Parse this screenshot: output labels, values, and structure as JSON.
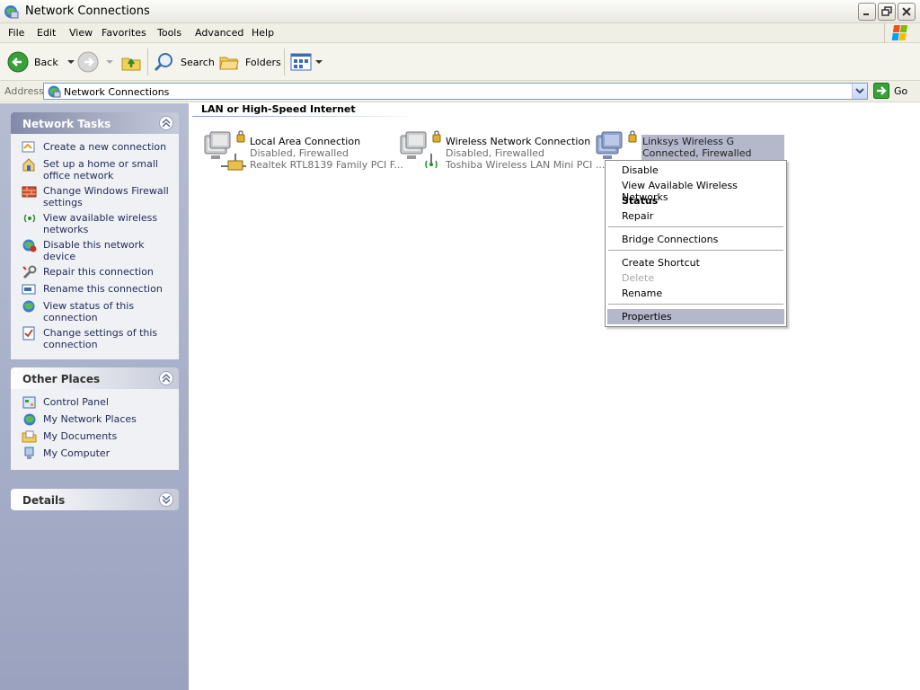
{
  "window": {
    "title": "Network Connections"
  },
  "menu": {
    "items": [
      "File",
      "Edit",
      "View",
      "Favorites",
      "Tools",
      "Advanced",
      "Help"
    ]
  },
  "toolbar": {
    "back": "Back",
    "search": "Search",
    "folders": "Folders"
  },
  "address": {
    "label": "Address",
    "value": "Network Connections",
    "go": "Go"
  },
  "network_tasks": {
    "title": "Network Tasks",
    "items": [
      [
        "Create a new connection"
      ],
      [
        "Set up a home or small",
        "office network"
      ],
      [
        "Change Windows Firewall",
        "settings"
      ],
      [
        "View available wireless",
        "networks"
      ],
      [
        "Disable this network device"
      ],
      [
        "Repair this connection"
      ],
      [
        "Rename this connection"
      ],
      [
        "View status of this",
        "connection"
      ],
      [
        "Change settings of this",
        "connection"
      ]
    ]
  },
  "other_places": {
    "title": "Other Places",
    "items": [
      "Control Panel",
      "My Network Places",
      "My Documents",
      "My Computer"
    ]
  },
  "details": {
    "title": "Details"
  },
  "content": {
    "group_title": "LAN or High-Speed Internet",
    "connections": [
      {
        "name": "Local Area Connection",
        "status": "Disabled, Firewalled",
        "device": "Realtek RTL8139 Family PCI F..."
      },
      {
        "name": "Wireless Network Connection",
        "status": "Disabled, Firewalled",
        "device": "Toshiba Wireless LAN Mini PCI ..."
      },
      {
        "name": "Linksys Wireless G",
        "status": "Connected, Firewalled"
      }
    ]
  },
  "context_menu": {
    "items": [
      "Disable",
      "View Available Wireless Networks",
      "Status",
      "Repair",
      "Bridge Connections",
      "Create Shortcut",
      "Delete",
      "Rename",
      "Properties"
    ]
  }
}
